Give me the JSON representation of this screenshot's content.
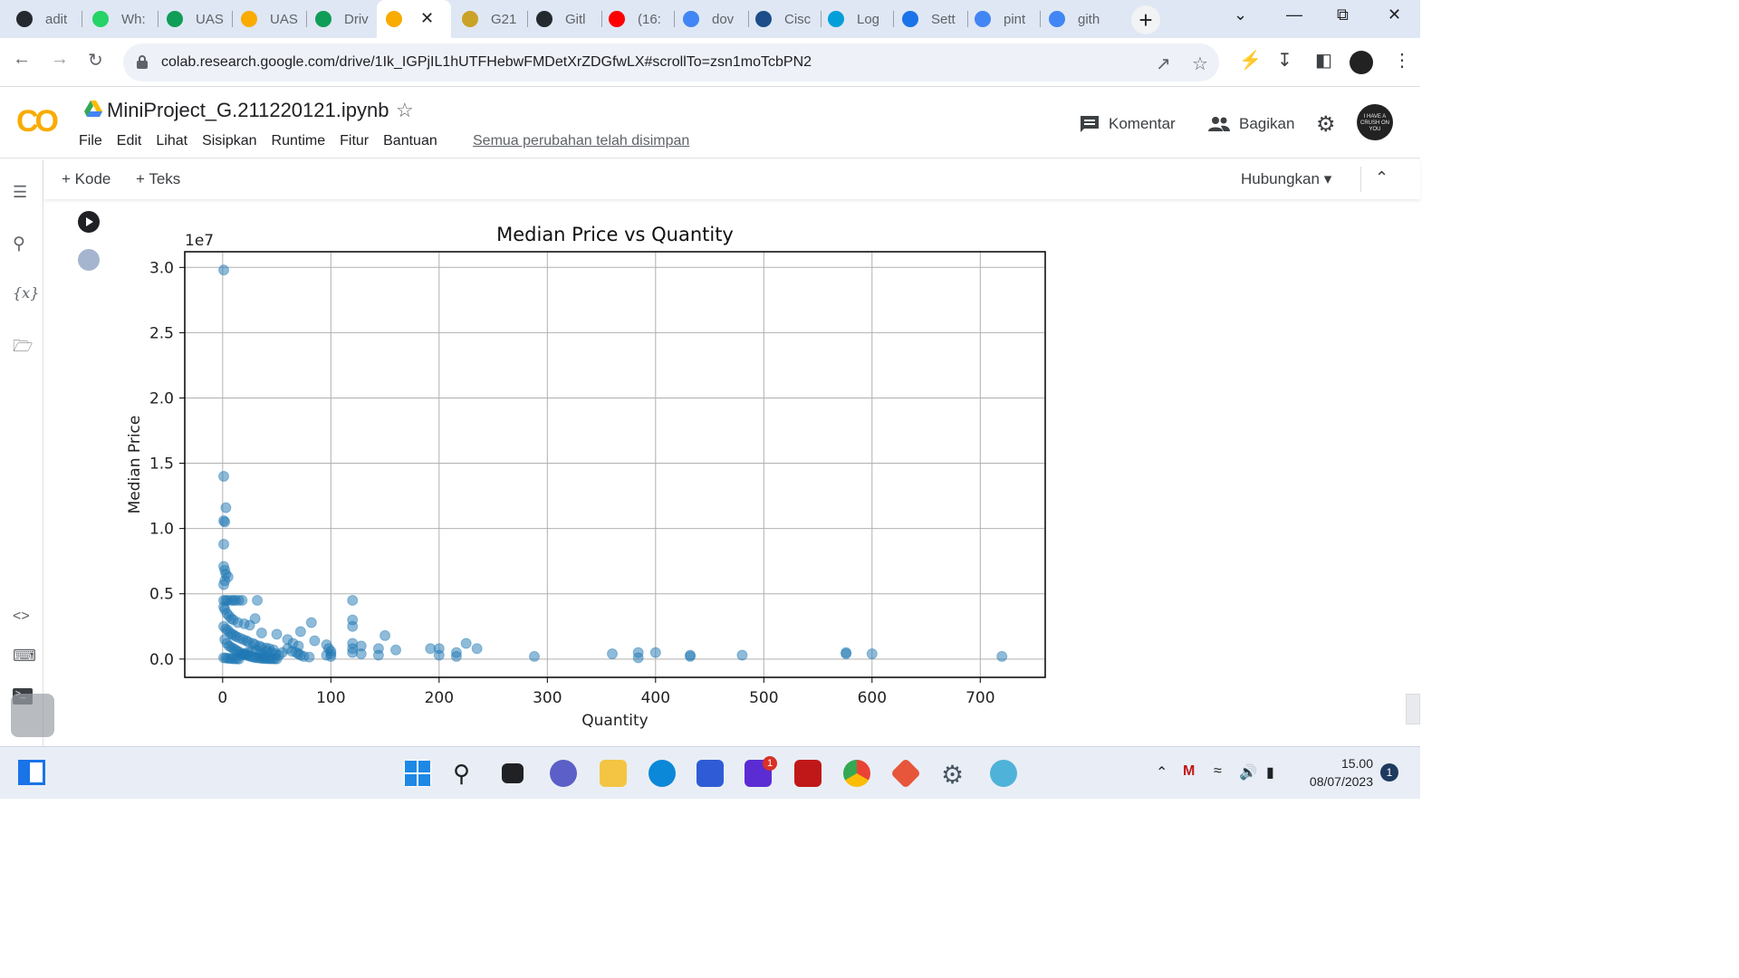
{
  "browser": {
    "tabs": [
      {
        "title": "adit",
        "icon": "github-icon",
        "color": "#24292f"
      },
      {
        "title": "Wh:",
        "icon": "whatsapp-icon",
        "color": "#25d366"
      },
      {
        "title": "UAS",
        "icon": "drive-icon",
        "color": "#0f9d58"
      },
      {
        "title": "UAS",
        "icon": "colab-icon",
        "color": "#f9ab00"
      },
      {
        "title": "Driv",
        "icon": "drive-icon",
        "color": "#0f9d58"
      },
      {
        "title": "",
        "icon": "colab-icon",
        "color": "#f9ab00",
        "active": true
      },
      {
        "title": "G21",
        "icon": "university-icon",
        "color": "#c9a227"
      },
      {
        "title": "Gitl",
        "icon": "github-icon",
        "color": "#24292f"
      },
      {
        "title": "(16:",
        "icon": "youtube-icon",
        "color": "#ff0000"
      },
      {
        "title": "dov",
        "icon": "google-icon",
        "color": "#4285f4"
      },
      {
        "title": "Cisc",
        "icon": "cisco-icon",
        "color": "#1d4e89"
      },
      {
        "title": "Log",
        "icon": "cisco-logo-icon",
        "color": "#049fd9"
      },
      {
        "title": "Sett",
        "icon": "settings-icon",
        "color": "#1a73e8"
      },
      {
        "title": "pint",
        "icon": "google-icon",
        "color": "#4285f4"
      },
      {
        "title": "gith",
        "icon": "google-icon",
        "color": "#4285f4"
      }
    ],
    "url": "colab.research.google.com/drive/1Ik_IGPjIL1hUTFHebwFMDetXrZDGfwLX#scrollTo=zsn1moTcbPN2"
  },
  "colab": {
    "notebook_title": "MiniProject_G.211220121.ipynb",
    "menu": [
      "File",
      "Edit",
      "Lihat",
      "Sisipkan",
      "Runtime",
      "Fitur",
      "Bantuan"
    ],
    "save_status": "Semua perubahan telah disimpan",
    "comment_label": "Komentar",
    "share_label": "Bagikan",
    "add_code_label": "+ Kode",
    "add_text_label": "+ Teks",
    "connect_label": "Hubungkan",
    "avatar_text": "I HAVE A CRUSH ON YOU"
  },
  "chart_data": {
    "type": "scatter",
    "title": "Median Price vs Quantity",
    "xlabel": "Quantity",
    "ylabel": "Median Price",
    "y_scale_label": "1e7",
    "xlim": [
      -35,
      760
    ],
    "ylim": [
      -1400000,
      31200000
    ],
    "x_ticks": [
      0,
      100,
      200,
      300,
      400,
      500,
      600,
      700
    ],
    "y_ticks": [
      0,
      5000000,
      10000000,
      15000000,
      20000000,
      25000000,
      30000000
    ],
    "y_tick_labels": [
      "0.0",
      "0.5",
      "1.0",
      "1.5",
      "2.0",
      "2.5",
      "3.0"
    ],
    "grid": true,
    "color": "#1f77b4",
    "points": [
      [
        1,
        29800000
      ],
      [
        1,
        14000000
      ],
      [
        3,
        11600000
      ],
      [
        1,
        10600000
      ],
      [
        2,
        10500000
      ],
      [
        1,
        8800000
      ],
      [
        1,
        7100000
      ],
      [
        2,
        6800000
      ],
      [
        3,
        6500000
      ],
      [
        5,
        6300000
      ],
      [
        2,
        6000000
      ],
      [
        1,
        5700000
      ],
      [
        1,
        4500000
      ],
      [
        3,
        4500000
      ],
      [
        5,
        4500000
      ],
      [
        8,
        4500000
      ],
      [
        10,
        4500000
      ],
      [
        12,
        4500000
      ],
      [
        15,
        4500000
      ],
      [
        18,
        4500000
      ],
      [
        32,
        4500000
      ],
      [
        120,
        4500000
      ],
      [
        1,
        4000000
      ],
      [
        2,
        3800000
      ],
      [
        4,
        3500000
      ],
      [
        6,
        3300000
      ],
      [
        8,
        3100000
      ],
      [
        10,
        3000000
      ],
      [
        14,
        2800000
      ],
      [
        20,
        2700000
      ],
      [
        25,
        2600000
      ],
      [
        1,
        2500000
      ],
      [
        3,
        2300000
      ],
      [
        5,
        2200000
      ],
      [
        7,
        2000000
      ],
      [
        9,
        1900000
      ],
      [
        11,
        1800000
      ],
      [
        13,
        1700000
      ],
      [
        16,
        1600000
      ],
      [
        19,
        1500000
      ],
      [
        22,
        1400000
      ],
      [
        24,
        1300000
      ],
      [
        28,
        1200000
      ],
      [
        30,
        1100000
      ],
      [
        34,
        1000000
      ],
      [
        36,
        900000
      ],
      [
        40,
        850000
      ],
      [
        43,
        800000
      ],
      [
        47,
        700000
      ],
      [
        2,
        1500000
      ],
      [
        4,
        1200000
      ],
      [
        6,
        1000000
      ],
      [
        8,
        900000
      ],
      [
        10,
        800000
      ],
      [
        12,
        700000
      ],
      [
        14,
        600000
      ],
      [
        16,
        500000
      ],
      [
        18,
        400000
      ],
      [
        20,
        350000
      ],
      [
        22,
        300000
      ],
      [
        24,
        250000
      ],
      [
        26,
        200000
      ],
      [
        28,
        150000
      ],
      [
        30,
        120000
      ],
      [
        32,
        100000
      ],
      [
        34,
        80000
      ],
      [
        36,
        60000
      ],
      [
        38,
        50000
      ],
      [
        40,
        40000
      ],
      [
        42,
        30000
      ],
      [
        44,
        25000
      ],
      [
        46,
        20000
      ],
      [
        48,
        15000
      ],
      [
        50,
        10000
      ],
      [
        1,
        100000
      ],
      [
        3,
        80000
      ],
      [
        5,
        60000
      ],
      [
        7,
        40000
      ],
      [
        9,
        30000
      ],
      [
        11,
        20000
      ],
      [
        13,
        10000
      ],
      [
        15,
        5000
      ],
      [
        17,
        300000
      ],
      [
        21,
        400000
      ],
      [
        23,
        500000
      ],
      [
        27,
        600000
      ],
      [
        31,
        700000
      ],
      [
        35,
        400000
      ],
      [
        37,
        300000
      ],
      [
        39,
        200000
      ],
      [
        41,
        600000
      ],
      [
        45,
        500000
      ],
      [
        49,
        400000
      ],
      [
        52,
        300000
      ],
      [
        55,
        500000
      ],
      [
        30,
        3100000
      ],
      [
        36,
        2000000
      ],
      [
        50,
        1900000
      ],
      [
        60,
        1500000
      ],
      [
        65,
        1200000
      ],
      [
        70,
        1000000
      ],
      [
        72,
        2100000
      ],
      [
        82,
        2800000
      ],
      [
        60,
        800000
      ],
      [
        64,
        600000
      ],
      [
        68,
        500000
      ],
      [
        70,
        400000
      ],
      [
        72,
        300000
      ],
      [
        75,
        200000
      ],
      [
        80,
        150000
      ],
      [
        85,
        1400000
      ],
      [
        96,
        1100000
      ],
      [
        98,
        800000
      ],
      [
        100,
        600000
      ],
      [
        100,
        400000
      ],
      [
        100,
        200000
      ],
      [
        96,
        300000
      ],
      [
        120,
        3000000
      ],
      [
        120,
        2500000
      ],
      [
        120,
        1200000
      ],
      [
        120,
        800000
      ],
      [
        120,
        500000
      ],
      [
        128,
        1000000
      ],
      [
        128,
        400000
      ],
      [
        144,
        800000
      ],
      [
        144,
        300000
      ],
      [
        150,
        1800000
      ],
      [
        160,
        700000
      ],
      [
        192,
        800000
      ],
      [
        200,
        800000
      ],
      [
        200,
        300000
      ],
      [
        216,
        500000
      ],
      [
        216,
        200000
      ],
      [
        225,
        1200000
      ],
      [
        235,
        800000
      ],
      [
        288,
        200000
      ],
      [
        360,
        400000
      ],
      [
        384,
        500000
      ],
      [
        384,
        100000
      ],
      [
        400,
        500000
      ],
      [
        432,
        300000
      ],
      [
        432,
        200000
      ],
      [
        480,
        300000
      ],
      [
        576,
        500000
      ],
      [
        576,
        400000
      ],
      [
        600,
        400000
      ],
      [
        720,
        200000
      ]
    ]
  },
  "rail_icons": [
    "toc-icon",
    "search-icon",
    "variables-icon",
    "files-icon",
    "code-snippets-icon",
    "command-palette-icon",
    "terminal-icon"
  ],
  "taskbar": {
    "clock_time": "15.00",
    "clock_date": "08/07/2023",
    "notification_count": "1",
    "app_badge": "1"
  }
}
